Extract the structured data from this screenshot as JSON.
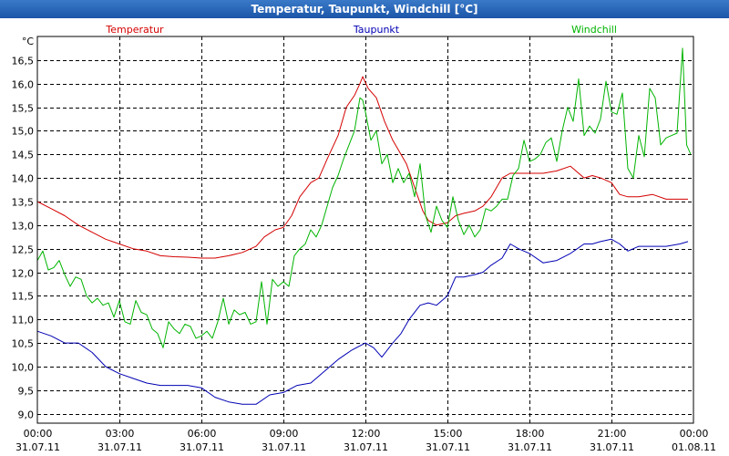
{
  "window": {
    "title": "Temperatur, Taupunkt, Windchill [°C]"
  },
  "chart_data": {
    "type": "line",
    "title": "Temperatur, Taupunkt, Windchill [°C]",
    "y_unit": "°C",
    "ylim": [
      8.8,
      17.0
    ],
    "y_ticks": [
      9.0,
      9.5,
      10.0,
      10.5,
      11.0,
      11.5,
      12.0,
      12.5,
      13.0,
      13.5,
      14.0,
      14.5,
      15.0,
      15.5,
      16.0,
      16.5
    ],
    "y_tick_labels": [
      "9,0",
      "9,5",
      "10,0",
      "10,5",
      "11,0",
      "11,5",
      "12,0",
      "12,5",
      "13,0",
      "13,5",
      "14,0",
      "14,5",
      "15,0",
      "15,5",
      "16,0",
      "16,5"
    ],
    "xlim_hours": [
      0,
      24
    ],
    "x_ticks_hours": [
      0,
      3,
      6,
      9,
      12,
      15,
      18,
      21,
      24
    ],
    "x_tick_times": [
      "00:00",
      "03:00",
      "06:00",
      "09:00",
      "12:00",
      "15:00",
      "18:00",
      "21:00",
      "00:00"
    ],
    "x_tick_dates": [
      "31.07.11",
      "31.07.11",
      "31.07.11",
      "31.07.11",
      "31.07.11",
      "31.07.11",
      "31.07.11",
      "31.07.11",
      "01.08.11"
    ],
    "grid": true,
    "legend_position": "top",
    "series": [
      {
        "name": "Temperatur",
        "color": "#d40000",
        "x": [
          0,
          0.5,
          1,
          1.5,
          2,
          2.5,
          3,
          3.5,
          4,
          4.5,
          5,
          5.5,
          6,
          6.5,
          7,
          7.5,
          8,
          8.3,
          8.7,
          9,
          9.3,
          9.6,
          10,
          10.3,
          10.6,
          11,
          11.3,
          11.6,
          11.8,
          11.9,
          12.1,
          12.4,
          12.7,
          13,
          13.3,
          13.5,
          13.8,
          14.1,
          14.3,
          14.6,
          15,
          15.3,
          15.6,
          16,
          16.3,
          16.6,
          17,
          17.3,
          17.6,
          18,
          18.5,
          19,
          19.5,
          20,
          20.3,
          20.6,
          21,
          21.3,
          21.6,
          22,
          22.5,
          23,
          23.5,
          23.8
        ],
        "y": [
          13.5,
          13.35,
          13.2,
          13.0,
          12.85,
          12.7,
          12.6,
          12.5,
          12.45,
          12.35,
          12.33,
          12.32,
          12.3,
          12.3,
          12.35,
          12.42,
          12.55,
          12.75,
          12.9,
          12.95,
          13.2,
          13.6,
          13.9,
          14.0,
          14.4,
          14.9,
          15.5,
          15.75,
          16.0,
          16.15,
          15.9,
          15.7,
          15.2,
          14.8,
          14.5,
          14.3,
          13.8,
          13.3,
          13.1,
          13.0,
          13.05,
          13.2,
          13.25,
          13.3,
          13.4,
          13.6,
          14.0,
          14.1,
          14.1,
          14.1,
          14.1,
          14.15,
          14.25,
          14.0,
          14.05,
          14.0,
          13.9,
          13.65,
          13.6,
          13.6,
          13.65,
          13.55,
          13.55,
          13.55
        ]
      },
      {
        "name": "Taupunkt",
        "color": "#0000b4",
        "x": [
          0,
          0.5,
          1,
          1.5,
          2,
          2.5,
          3,
          3.5,
          4,
          4.5,
          5,
          5.5,
          6,
          6.5,
          7,
          7.5,
          8,
          8.5,
          9,
          9.5,
          10,
          10.5,
          11,
          11.5,
          12,
          12.3,
          12.6,
          13,
          13.3,
          13.6,
          14,
          14.3,
          14.6,
          15,
          15.3,
          15.6,
          16,
          16.3,
          16.6,
          17,
          17.3,
          17.6,
          18,
          18.5,
          19,
          19.5,
          20,
          20.3,
          20.6,
          21,
          21.3,
          21.6,
          22,
          22.5,
          23,
          23.5,
          23.8
        ],
        "y": [
          10.75,
          10.65,
          10.5,
          10.5,
          10.3,
          10.0,
          9.85,
          9.75,
          9.65,
          9.6,
          9.6,
          9.6,
          9.55,
          9.35,
          9.25,
          9.2,
          9.2,
          9.4,
          9.45,
          9.6,
          9.65,
          9.9,
          10.15,
          10.35,
          10.5,
          10.4,
          10.2,
          10.5,
          10.7,
          11.0,
          11.3,
          11.35,
          11.3,
          11.5,
          11.9,
          11.9,
          11.95,
          12.0,
          12.15,
          12.3,
          12.6,
          12.5,
          12.4,
          12.2,
          12.25,
          12.4,
          12.6,
          12.6,
          12.65,
          12.7,
          12.6,
          12.45,
          12.55,
          12.55,
          12.55,
          12.6,
          12.65
        ]
      },
      {
        "name": "Windchill",
        "color": "#00b400",
        "x": [
          0,
          0.2,
          0.4,
          0.6,
          0.8,
          1,
          1.2,
          1.4,
          1.6,
          1.8,
          2,
          2.2,
          2.4,
          2.6,
          2.8,
          3,
          3.2,
          3.4,
          3.6,
          3.8,
          4,
          4.2,
          4.4,
          4.6,
          4.8,
          5,
          5.2,
          5.4,
          5.6,
          5.8,
          6,
          6.2,
          6.4,
          6.6,
          6.8,
          7,
          7.2,
          7.4,
          7.6,
          7.8,
          8,
          8.2,
          8.4,
          8.6,
          8.8,
          9,
          9.2,
          9.4,
          9.6,
          9.8,
          10,
          10.2,
          10.4,
          10.6,
          10.8,
          11,
          11.2,
          11.4,
          11.6,
          11.8,
          11.9,
          12,
          12.2,
          12.4,
          12.6,
          12.8,
          13,
          13.2,
          13.4,
          13.6,
          13.8,
          14,
          14.2,
          14.4,
          14.6,
          14.8,
          15,
          15.2,
          15.4,
          15.6,
          15.8,
          16,
          16.2,
          16.4,
          16.6,
          16.8,
          17,
          17.2,
          17.4,
          17.6,
          17.8,
          18,
          18.2,
          18.4,
          18.6,
          18.8,
          19,
          19.2,
          19.4,
          19.6,
          19.8,
          20,
          20.2,
          20.4,
          20.6,
          20.8,
          21,
          21.2,
          21.4,
          21.6,
          21.8,
          22,
          22.2,
          22.4,
          22.6,
          22.8,
          23,
          23.2,
          23.4,
          23.6,
          23.75,
          23.9
        ],
        "y": [
          12.25,
          12.45,
          12.05,
          12.1,
          12.25,
          11.95,
          11.7,
          11.9,
          11.85,
          11.5,
          11.35,
          11.45,
          11.3,
          11.35,
          11.05,
          11.4,
          10.95,
          10.9,
          11.4,
          11.15,
          11.1,
          10.8,
          10.7,
          10.4,
          10.95,
          10.8,
          10.7,
          10.9,
          10.85,
          10.6,
          10.65,
          10.75,
          10.6,
          10.95,
          11.45,
          10.9,
          11.2,
          11.1,
          11.15,
          10.9,
          10.95,
          11.8,
          10.9,
          11.85,
          11.7,
          11.8,
          11.7,
          12.35,
          12.5,
          12.6,
          12.9,
          12.75,
          13.0,
          13.4,
          13.8,
          14.05,
          14.4,
          14.7,
          15.0,
          15.7,
          15.65,
          15.4,
          14.8,
          15.0,
          14.3,
          14.5,
          13.9,
          14.2,
          13.9,
          14.1,
          13.6,
          14.3,
          13.2,
          12.85,
          13.4,
          13.1,
          12.95,
          13.6,
          13.1,
          12.8,
          13.0,
          12.75,
          12.9,
          13.35,
          13.3,
          13.4,
          13.55,
          13.55,
          14.05,
          14.2,
          14.8,
          14.35,
          14.4,
          14.5,
          14.75,
          14.85,
          14.35,
          15.0,
          15.5,
          15.2,
          16.1,
          14.9,
          15.1,
          14.95,
          15.25,
          16.05,
          15.4,
          15.35,
          15.8,
          14.2,
          14.0,
          14.9,
          14.45,
          15.9,
          15.7,
          14.7,
          14.85,
          14.9,
          14.95,
          16.75,
          14.7,
          14.5
        ]
      }
    ]
  }
}
